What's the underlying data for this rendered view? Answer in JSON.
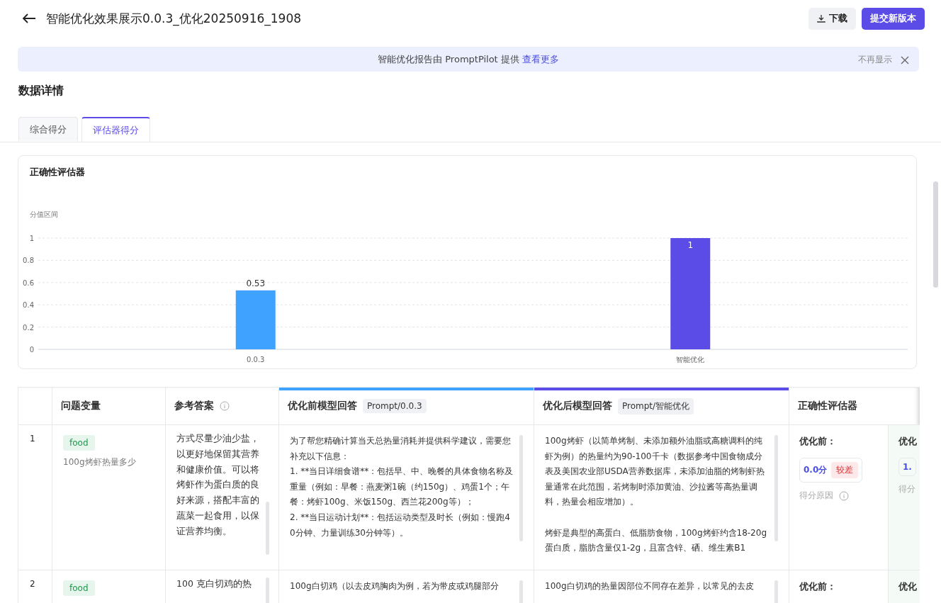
{
  "header": {
    "title": "智能优化效果展示0.0.3_优化20250916_1908",
    "buttons": [
      {
        "label": "下载",
        "kind": "download"
      },
      {
        "label": "提交新版本",
        "kind": "primary"
      }
    ]
  },
  "banner": {
    "text": "智能优化报告由 PromptPilot 提供",
    "link": "查看更多",
    "dismiss": "不再显示"
  },
  "section_title": "数据详情",
  "tabs": [
    {
      "label": "综合得分",
      "selected": false
    },
    {
      "label": "评估器得分",
      "selected": true
    }
  ],
  "chart_card": {
    "title": "正确性评估器",
    "chart_data": {
      "type": "bar",
      "ylabel": "分值区间",
      "categories": [
        "0.0.3",
        "智能优化"
      ],
      "values": [
        0.53,
        1
      ],
      "colors": [
        "#3fa2ff",
        "#5b4ce8"
      ],
      "ylim": [
        0,
        1
      ],
      "yticks": [
        0,
        0.2,
        0.4,
        0.6,
        0.8,
        1
      ],
      "grid": true,
      "data_labels": true
    }
  },
  "table": {
    "columns": [
      {
        "label": "问题变量"
      },
      {
        "label": "参考答案",
        "info": true
      },
      {
        "label": "优化前模型回答",
        "tag": "Prompt/0.0.3",
        "color": "#3fa2ff"
      },
      {
        "label": "优化后模型回答",
        "tag": "Prompt/智能优化",
        "color": "#5b4ce8"
      },
      {
        "label": "正确性评估器"
      }
    ],
    "rows": [
      {
        "index": "1",
        "variable_tag": "food",
        "question": "100g烤虾热量多少",
        "reference": "方式尽量少油少盐，以更好地保留其营养和健康价值。可以将烤虾作为蛋白质的良好来源，搭配丰富的蔬菜一起食用，以保证营养均衡。",
        "before": [
          "为了帮您精确计算当天总热量消耗并提供科学建议，需要您补充以下信息：",
          "1. **当日详细食谱**：包括早、中、晚餐的具体食物名称及重量（例如：早餐：燕麦粥1碗（约150g）、鸡蛋1个；午餐：烤虾100g、米饭150g、西兰花200g等）；",
          "2. **当日运动计划**：包括运动类型及时长（例如：慢跑40分钟、力量训练30分钟等）。"
        ],
        "after": [
          "100g烤虾（以简单烤制、未添加额外油脂或高糖调料的纯虾为例）的热量约为90-100千卡（数据参考中国食物成分表及美国农业部USDA营养数据库，未添加油脂的烤制虾热量通常在此范围，若烤制时添加黄油、沙拉酱等高热量调料，热量会相应增加）。",
          "烤虾是典型的高蛋白、低脂肪食物，100g烤虾约含18-20g蛋白质，脂肪含量仅1-2g，且富含锌、硒、维生素B1"
        ],
        "eval": [
          {
            "label": "优化前：",
            "score": "0.0分",
            "grade": "较差",
            "reason": "得分原因"
          },
          {
            "label": "优化",
            "score": "1.",
            "reason": "得分"
          }
        ]
      },
      {
        "index": "2",
        "variable_tag": "food",
        "reference": "100 克白切鸡的热",
        "before": [
          "100g白切鸡（以去皮鸡胸肉为例，若为带皮或鸡腿部分"
        ],
        "after": [
          "100g白切鸡的热量因部位不同存在差异，以常见的去皮"
        ],
        "eval": [
          {
            "label": "优化前："
          },
          {
            "label": "优化"
          }
        ]
      }
    ]
  }
}
